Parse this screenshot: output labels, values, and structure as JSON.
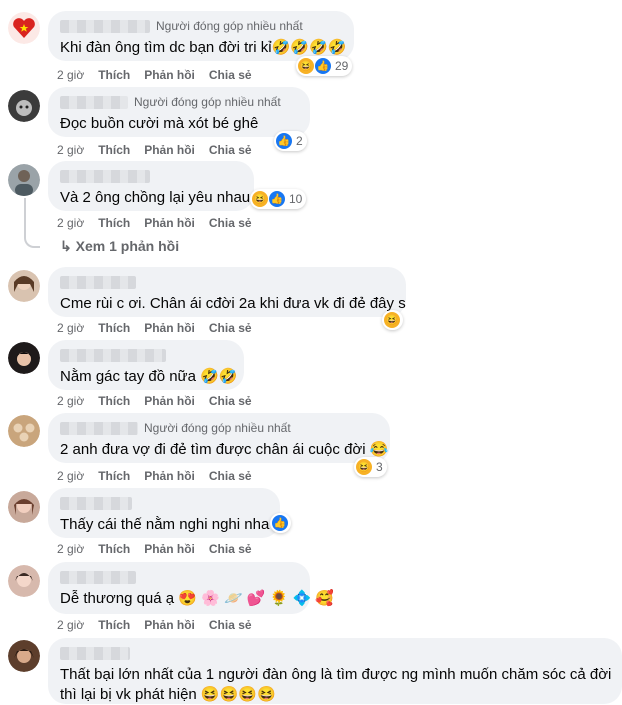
{
  "badge_text": "Người đóng góp nhiều nhất",
  "actions": {
    "time": "2 giờ",
    "like": "Thích",
    "reply": "Phản hồi",
    "share": "Chia sẻ"
  },
  "see_replies": "Xem 1 phản hồi",
  "comments": [
    {
      "text": "Khi đàn ông tìm dc bạn đời tri kỉ🤣🤣🤣🤣",
      "reaction_count": "29",
      "reactions": [
        "haha",
        "like"
      ],
      "top_fan": true
    },
    {
      "text": "Đọc buồn cười mà xót bé ghê",
      "reaction_count": "2",
      "reactions": [
        "like"
      ],
      "top_fan": true
    },
    {
      "text": "Và 2 ông chồng lại yêu nhau",
      "reaction_count": "10",
      "reactions": [
        "haha",
        "like"
      ],
      "top_fan": false
    },
    {
      "text": "Cme rùi c ơi. Chân ái cđời 2a khi đưa vk đi đẻ đây s",
      "reaction_count": "",
      "reactions": [
        "haha"
      ],
      "top_fan": false
    },
    {
      "text": "Nằm gác tay đồ nữa 🤣🤣",
      "reaction_count": "",
      "reactions": [],
      "top_fan": false
    },
    {
      "text": "2 anh đưa vợ đi đẻ tìm được chân ái cuộc đời 😂",
      "reaction_count": "3",
      "reactions": [
        "haha"
      ],
      "top_fan": true
    },
    {
      "text": "Thấy cái thế nằm nghi nghi nha",
      "reaction_count": "",
      "reactions": [
        "like"
      ],
      "top_fan": false
    },
    {
      "text": "Dễ thương quá ạ 😍 🌸 🪐 💕 🌻 💠 🥰",
      "reaction_count": "",
      "reactions": [],
      "top_fan": false
    },
    {
      "text_line1": "Thất bại lớn nhất của 1 người đàn ông là tìm được ng mình muốn chăm sóc cả đời",
      "text_line2": "thì lại bị vk phát hiện 😆😆😆😆",
      "reactions": [],
      "top_fan": false
    }
  ],
  "colors": {
    "bubble": "#f0f2f5",
    "like": "#1877f2",
    "haha": "#f7b125",
    "meta": "#65676b"
  },
  "icons": [
    "like-icon",
    "haha-icon",
    "reply-arrow-icon"
  ]
}
